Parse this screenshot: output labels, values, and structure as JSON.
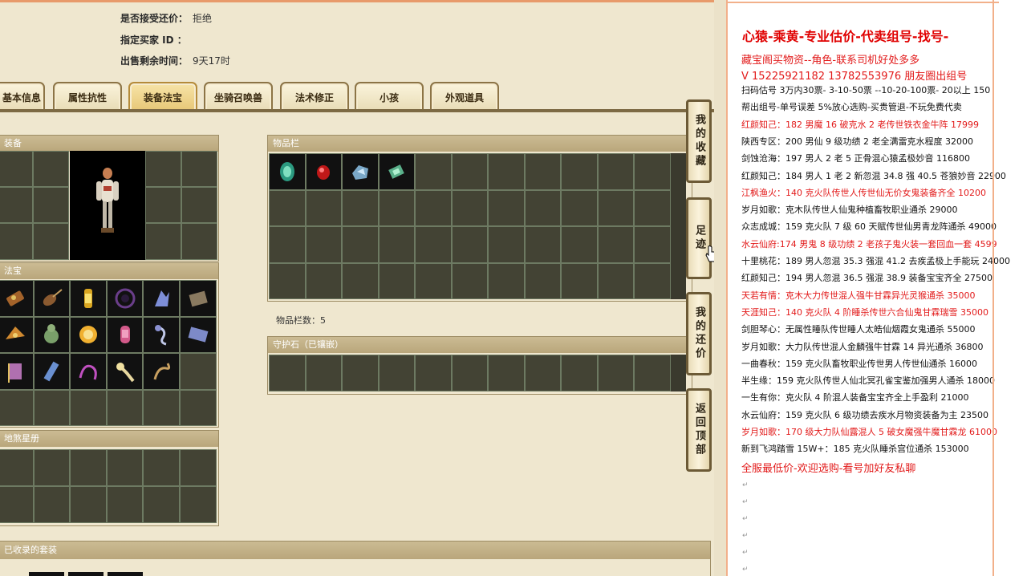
{
  "header": {
    "accept_counter_label": "是否接受还价：",
    "accept_counter_value": "拒绝",
    "buyer_id_label": "指定买家 ID ：",
    "time_left_label": "出售剩余时间：",
    "time_left_value": "9天17时"
  },
  "tabs": [
    {
      "label": "基本信息"
    },
    {
      "label": "属性抗性"
    },
    {
      "label": "装备法宝",
      "active": true
    },
    {
      "label": "坐骑召唤兽"
    },
    {
      "label": "法术修正"
    },
    {
      "label": "小孩"
    },
    {
      "label": "外观道具"
    }
  ],
  "panels": {
    "equipment": "装备",
    "treasure": "法宝",
    "star_chart": "地煞星册",
    "inventory": "物品栏",
    "guardian": "守护石（已镶嵌）",
    "suits": "已收录的套装"
  },
  "inventory_count": "物品栏数：5",
  "side_buttons": [
    {
      "label": "我的收藏"
    },
    {
      "label": "足迹"
    },
    {
      "label": "我的还价"
    },
    {
      "label": "返回顶部"
    }
  ],
  "notes": {
    "watermark": "",
    "title": "心猿-乘黄-专业估价-代卖组号-找号-",
    "lines": [
      {
        "text": "藏宝阁买物资--角色-联系司机好处多多",
        "color": "red",
        "big": true
      },
      {
        "text": "V 15225921182   13782553976 朋友圈出组号",
        "color": "red",
        "big": true
      },
      {
        "text": "扫码估号 3万内30票- 3-10-50票  --10-20-100票- 20以上 150",
        "color": "black"
      },
      {
        "text": "帮出组号-单号误差 5%放心选购-买贵管退-不玩免费代卖",
        "color": "black"
      },
      {
        "text": "红颜知己：182 男魔 16 破克水 2 老传世铁衣金牛阵 17999",
        "color": "red"
      },
      {
        "text": "陕西专区：200 男仙 9 级功绩 2 老全满雷克水程度 32000",
        "color": "black"
      },
      {
        "text": "剑蚀沧海：197 男人 2 老 5 正骨混心猿孟极妙音 116800",
        "color": "black"
      },
      {
        "text": "红颜知己：184 男人 1 老 2 新忽混 34.8 强 40.5 苍狼妙音 22900",
        "color": "black"
      },
      {
        "text": "江枫渔火：140 克火队传世人传世仙无价女鬼装备齐全 10200",
        "color": "red"
      },
      {
        "text": "岁月如歌：克木队传世人仙鬼种植畜牧职业通杀 29000",
        "color": "black"
      },
      {
        "text": "众志成城：159 克火队 7 级 60 天赋传世仙男青龙阵通杀 49000",
        "color": "black"
      },
      {
        "text": "水云仙府:174 男鬼 8 级功绩 2 老孩子鬼火装一套回血一套 4599",
        "color": "red"
      },
      {
        "text": "十里桃花：189 男人忽混 35.3 强混 41.2 去疾孟极上手能玩 24000",
        "color": "black"
      },
      {
        "text": "红颜知己：194 男人忽混 36.5 强混 38.9 装备宝宝齐全 27500",
        "color": "black"
      },
      {
        "text": "天若有情：克木大力传世混人强牛甘霖异光灵猴通杀 35000",
        "color": "red"
      },
      {
        "text": "天涯知己：140 克火队 4 阶睡杀传世六合仙鬼甘霖瑞雪 35000",
        "color": "red"
      },
      {
        "text": "剑胆琴心：无属性睡队传世睡人太皓仙烟霞女鬼通杀 55000",
        "color": "black"
      },
      {
        "text": "岁月如歌：大力队传世混人金麟强牛甘霖 14 异光通杀 36800",
        "color": "black"
      },
      {
        "text": "一曲春秋：159 克火队畜牧职业传世男人传世仙通杀 16000",
        "color": "black"
      },
      {
        "text": "半生缘：159 克火队传世人仙北冥孔雀宝鉴加强男人通杀 18000",
        "color": "black"
      },
      {
        "text": "一生有你：克火队 4 阶混人装备宝宝齐全上手盈利 21000",
        "color": "black"
      },
      {
        "text": "水云仙府：159 克火队 6 级功绩去疾水月物资装备为主 23500",
        "color": "black"
      },
      {
        "text": "岁月如歌：170 级大力队仙露混人 5 破女魔强牛魔甘霖龙 61000",
        "color": "red"
      },
      {
        "text": "新到飞鸿踏雪 15W+：185 克火队睡杀宫位通杀 153000",
        "color": "black"
      },
      {
        "text": "全服最低价-欢迎选购-看号加好友私聊",
        "color": "red",
        "big": true
      }
    ]
  },
  "colors": {
    "accent_red": "#e21a1a",
    "tab_border": "#8c7446",
    "panel_head": "#b9a67b",
    "slot_bg": "#434334"
  }
}
